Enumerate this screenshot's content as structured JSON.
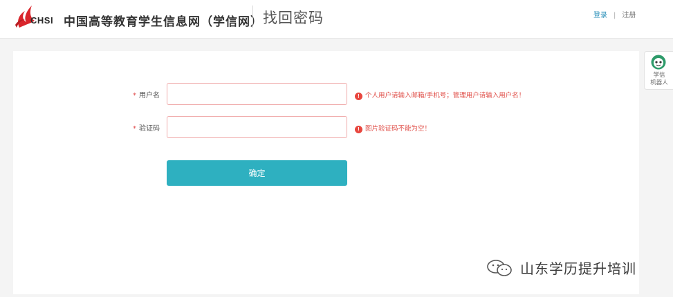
{
  "header": {
    "logo_text": "CHSI",
    "site_name": "中国高等教育学生信息网（学信网）",
    "page_title": "找回密码",
    "login_link": "登录",
    "separator": "|",
    "register_link": "注册"
  },
  "form": {
    "required_mark": "*",
    "username": {
      "label": "用户名",
      "value": "",
      "error": "个人用户请输入邮箱/手机号；管理用户请输入用户名！"
    },
    "captcha": {
      "label": "验证码",
      "value": "",
      "error": "图片验证码不能为空！"
    },
    "error_icon_glyph": "!",
    "submit_label": "确定"
  },
  "robot": {
    "label_line1": "学信",
    "label_line2": "机器人"
  },
  "watermark": {
    "text": "山东学历提升培训"
  },
  "colors": {
    "accent_button": "#2eb0c0",
    "error": "#e0504a",
    "link": "#2a8fb8",
    "input_error_border": "#f0a9a9"
  },
  "icons": {
    "logo": "chsi-red-flame-logo",
    "error": "exclamation-circle-icon",
    "robot": "robot-avatar-icon",
    "watermark": "wechat-icon"
  }
}
